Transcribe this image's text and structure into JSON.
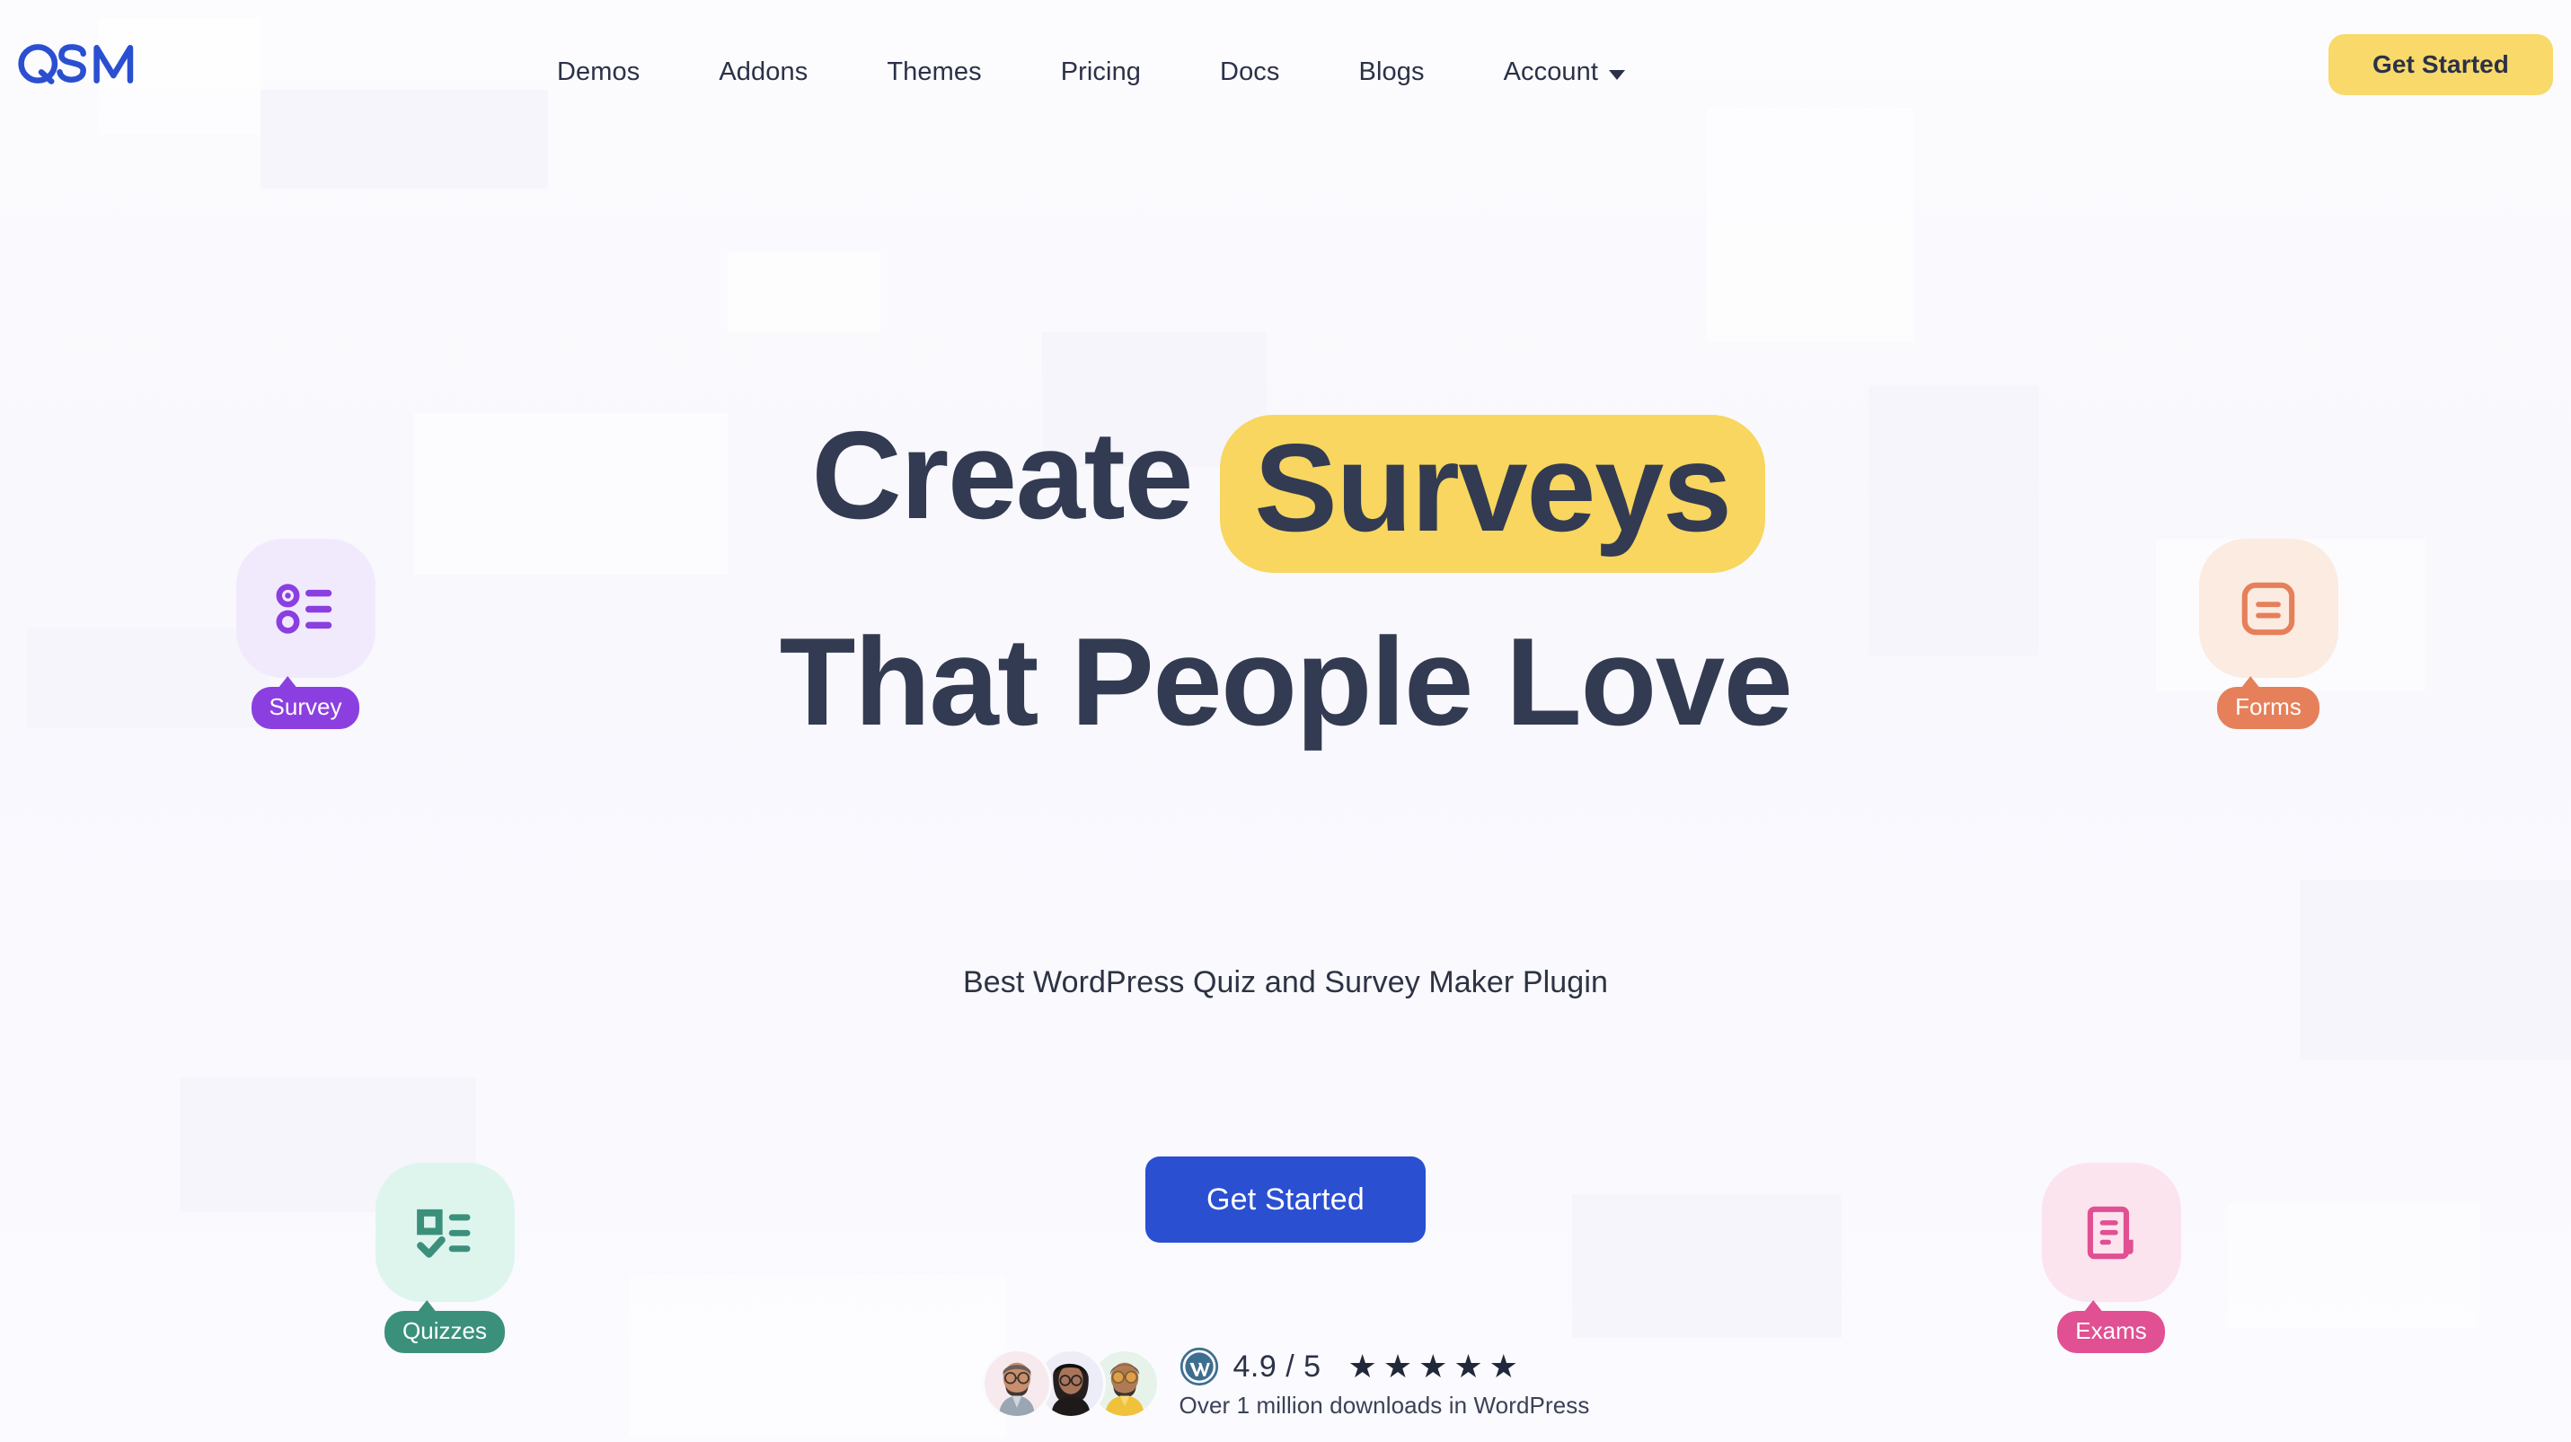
{
  "brand": {
    "logo_text": "QSM",
    "logo_color": "#2b4fd1"
  },
  "header": {
    "nav_items": [
      {
        "label": "Demos",
        "icon": "",
        "has_dropdown": false
      },
      {
        "label": "Addons",
        "icon": "",
        "has_dropdown": false
      },
      {
        "label": "Themes",
        "icon": "",
        "has_dropdown": false
      },
      {
        "label": "Pricing",
        "icon": "",
        "has_dropdown": false
      },
      {
        "label": "Docs",
        "icon": "",
        "has_dropdown": false
      },
      {
        "label": "Blogs",
        "icon": "",
        "has_dropdown": false
      },
      {
        "label": "Account",
        "icon": "chevron-down-icon",
        "has_dropdown": true
      }
    ],
    "cta_label": "Get Started",
    "cta_bg": "#f8d96a"
  },
  "hero": {
    "headline_line1_plain": "Create",
    "headline_line1_highlight": "Surveys",
    "headline_line2": "That People Love",
    "highlight_bg": "#f8d65f",
    "headline_color": "#333b52",
    "subtitle": "Best WordPress Quiz and Survey Maker Plugin",
    "cta_label": "Get Started",
    "cta_bg": "#2b4fd1"
  },
  "social_proof": {
    "score": "4.9 / 5",
    "stars": "★★★★★",
    "star_count": 5,
    "downloads_text": "Over 1 million downloads in WordPress",
    "platform_icon": "wordpress-icon",
    "avatars": [
      {
        "name": "avatar-user-1",
        "bg": "#f7eaef"
      },
      {
        "name": "avatar-user-2",
        "bg": "#ededf8"
      },
      {
        "name": "avatar-user-3",
        "bg": "#e7f3ea"
      }
    ]
  },
  "feature_badges": [
    {
      "key": "survey",
      "label": "Survey",
      "icon": "radio-list-icon",
      "icon_bg": "#f1eafd",
      "pill_bg": "#8b3fe0",
      "accent": "#8b3fe0"
    },
    {
      "key": "forms",
      "label": "Forms",
      "icon": "form-square-icon",
      "icon_bg": "#fcebe0",
      "pill_bg": "#e5805a",
      "accent": "#e5805a"
    },
    {
      "key": "quizzes",
      "label": "Quizzes",
      "icon": "checklist-icon",
      "icon_bg": "#def5ee",
      "pill_bg": "#3b907c",
      "accent": "#3b907c"
    },
    {
      "key": "exams",
      "label": "Exams",
      "icon": "exam-document-icon",
      "icon_bg": "#fce4ef",
      "pill_bg": "#e05092",
      "accent": "#e05092"
    }
  ]
}
